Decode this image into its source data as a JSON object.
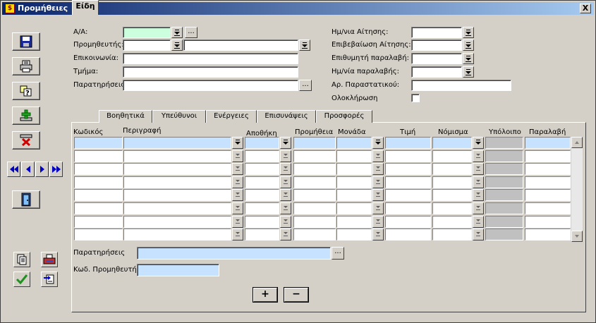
{
  "window": {
    "title": "Προμήθειες",
    "close_label": "X"
  },
  "header_left": {
    "aa_label": "Α/Α:",
    "supplier_label": "Προμηθευτής:",
    "contact_label": "Επικοινωνία:",
    "department_label": "Τμήμα:",
    "notes_label": "Παρατηρήσεις:",
    "ellipsis": "..."
  },
  "header_right": {
    "request_date_label": "Ημ/νια Αίτησης:",
    "request_confirm_label": "Επιβεβαίωση Αίτησης:",
    "desired_receipt_label": "Επιθυμητή παραλαβή:",
    "receipt_date_label": "Ημ/νία παραλαβής:",
    "doc_number_label": "Αρ. Παραστατικού:",
    "completion_label": "Ολοκλήρωση"
  },
  "tabs": [
    {
      "label": "Είδη"
    },
    {
      "label": "Βοηθητικά"
    },
    {
      "label": "Υπεύθυνοι"
    },
    {
      "label": "Ενέργειες"
    },
    {
      "label": "Επισυνάψεις"
    },
    {
      "label": "Προσφορές"
    }
  ],
  "grid": {
    "columns": [
      "Κωδικός",
      "Περιγραφή",
      "Αποθήκη",
      "Προμήθεια",
      "Μονάδα",
      "Τιμή",
      "Νόμισμα",
      "Υπόλοιπο",
      "Παραλαβή"
    ]
  },
  "footer": {
    "notes_label": "Παρατηρήσεις",
    "supplier_code_label": "Κωδ. Προμηθευτή",
    "ellipsis": "...",
    "add_label": "+",
    "remove_label": "−"
  },
  "icons": {
    "save": "floppy-disk-icon",
    "print": "printer-icon",
    "query": "query-icon",
    "add": "add-plus-icon",
    "delete": "delete-x-icon",
    "exit": "exit-door-icon"
  }
}
